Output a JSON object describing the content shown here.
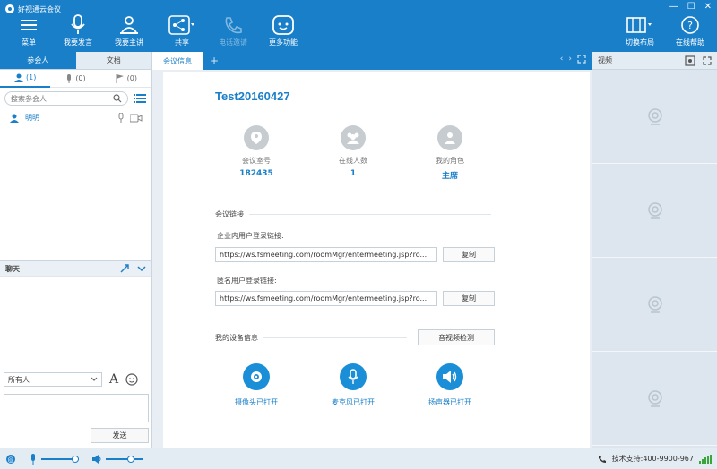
{
  "app": {
    "title": "好视通云会议"
  },
  "toolbar": {
    "menu": "菜单",
    "request_speak": "我要发言",
    "request_host": "我要主讲",
    "share": "共享",
    "call_invite": "电话邀请",
    "more": "更多功能",
    "switch_layout": "切换布局",
    "online_help": "在线帮助"
  },
  "left": {
    "tabs": [
      "参会人",
      "文档"
    ],
    "subtabs": [
      {
        "icon": "user-icon",
        "count": "(1)"
      },
      {
        "icon": "mic-icon",
        "count": "(0)"
      },
      {
        "icon": "flag-icon",
        "count": "(0)"
      }
    ],
    "search_placeholder": "搜索参会人",
    "members": [
      {
        "name": "明明"
      }
    ],
    "chat": {
      "title": "聊天",
      "recipient": "所有人",
      "send": "发送"
    }
  },
  "center": {
    "tab": "会议信息",
    "meeting_title": "Test20160427",
    "stats": [
      {
        "label": "会议室号",
        "value": "182435",
        "icon": "location-icon"
      },
      {
        "label": "在线人数",
        "value": "1",
        "icon": "group-icon"
      },
      {
        "label": "我的角色",
        "value": "主席",
        "icon": "person-icon"
      }
    ],
    "links_section": "会议链接",
    "enterprise_label": "企业内用户登录链接:",
    "enterprise_url": "https://ws.fsmeeting.com/roomMgr/entermeeting.jsp?ro...",
    "anonymous_label": "匿名用户登录链接:",
    "anonymous_url": "https://ws.fsmeeting.com/roomMgr/entermeeting.jsp?ro...",
    "copy": "复制",
    "device_section": "我的设备信息",
    "av_check": "音视频检测",
    "devices": [
      {
        "label": "摄像头已打开",
        "icon": "camera-icon"
      },
      {
        "label": "麦克风已打开",
        "icon": "mic-icon"
      },
      {
        "label": "扬声器已打开",
        "icon": "speaker-icon"
      }
    ]
  },
  "right": {
    "title": "视频"
  },
  "status": {
    "support": "技术支持:400-9900-967",
    "mic_volume": 0.8,
    "speaker_volume": 0.6
  },
  "colors": {
    "brand": "#1a7fc9",
    "accent": "#1a8fd8"
  }
}
